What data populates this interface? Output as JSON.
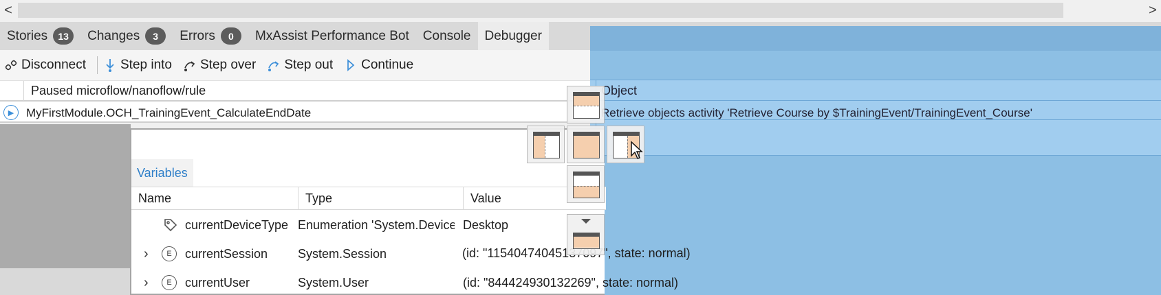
{
  "scrollbar": {
    "left_arrow": "<",
    "right_arrow": ">"
  },
  "tabs": [
    {
      "label": "Stories",
      "count": "13"
    },
    {
      "label": "Changes",
      "count": "3"
    },
    {
      "label": "Errors",
      "count": "0"
    },
    {
      "label": "MxAssist Performance Bot",
      "count": ""
    },
    {
      "label": "Console",
      "count": ""
    },
    {
      "label": "Debugger",
      "count": ""
    }
  ],
  "toolbar": {
    "disconnect": "Disconnect",
    "step_into": "Step into",
    "step_over": "Step over",
    "step_out": "Step out",
    "continue": "Continue"
  },
  "paused": {
    "header": "Paused microflow/nanoflow/rule",
    "row_name": "MyFirstModule.OCH_TrainingEvent_CalculateEndDate",
    "object_header": "Object",
    "object_value": "Retrieve objects activity 'Retrieve Course by $TrainingEvent/TrainingEvent_Course'"
  },
  "variables": {
    "tab": "Variables",
    "headers": {
      "name": "Name",
      "type": "Type",
      "value": "Value"
    },
    "rows": [
      {
        "name": "currentDeviceType",
        "type": "Enumeration 'System.Device...",
        "value": "Desktop",
        "icon": "tag-icon"
      },
      {
        "name": "currentSession",
        "type": "System.Session",
        "value": "(id: \"11540474045137097\", state: normal)",
        "icon": "entity-icon"
      },
      {
        "name": "currentUser",
        "type": "System.User",
        "value": "(id: \"844424930132269\", state: normal)",
        "icon": "entity-icon"
      }
    ]
  },
  "colors": {
    "accent": "#3c8fd9",
    "dock_overlay": "#8dbfe4",
    "dock_fill": "#f5cfae"
  }
}
